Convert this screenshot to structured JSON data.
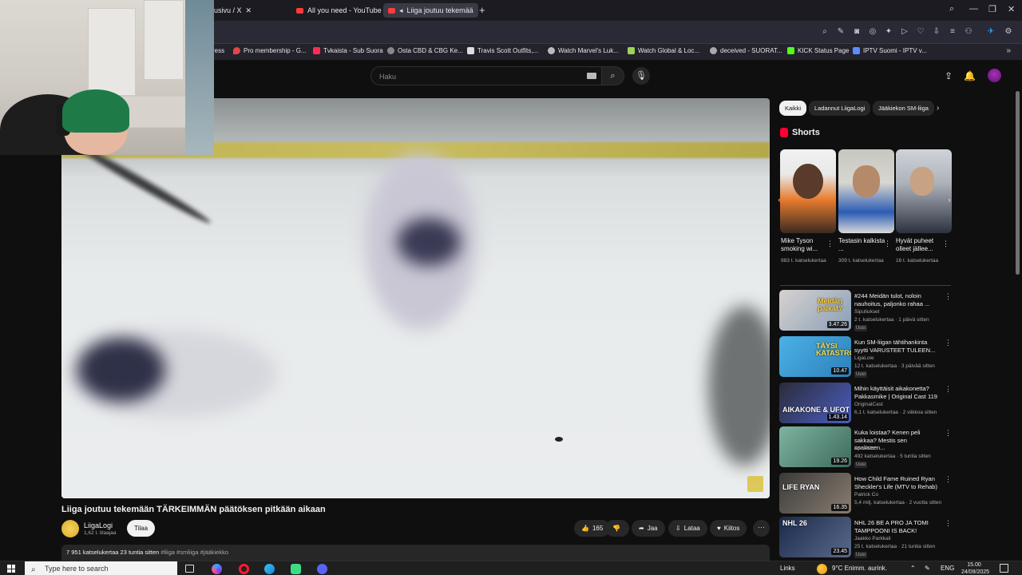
{
  "browser": {
    "tabs": [
      {
        "label": "usivu / X",
        "active": false
      },
      {
        "label": "All you need - YouTube",
        "active": false
      },
      {
        "label": "Liiga joutuu tekemää",
        "active": true
      }
    ],
    "new_tab": "+",
    "bookmarks": [
      {
        "label": "ress",
        "color": "#777777"
      },
      {
        "label": "Pro membership - G...",
        "color": "#e04848"
      },
      {
        "label": "Tvkaista - Sub Suora",
        "color": "#ff2d55"
      },
      {
        "label": "Osta CBD & CBG Ke...",
        "color": "#888888"
      },
      {
        "label": "Travis Scott Outfits,...",
        "color": "#dddddd"
      },
      {
        "label": "Watch Marvel's Luk...",
        "color": "#bbbbbb"
      },
      {
        "label": "Watch Global & Loc...",
        "color": "#9bd35a"
      },
      {
        "label": "deceived - SUORAT...",
        "color": "#aaaaaa"
      },
      {
        "label": "KICK Status Page",
        "color": "#53fc18"
      },
      {
        "label": "IPTV Suomi - IPTV v...",
        "color": "#5c8cff"
      }
    ],
    "bookmarks_more": "»"
  },
  "youtube_header": {
    "search_placeholder": "Haku"
  },
  "video": {
    "title": "Liiga joutuu tekemään TÄRKEIMMÄN päätöksen pitkään aikaan",
    "channel": "LiigaLogi",
    "subscribers": "1,62 t. tilaajaa",
    "subscribe_label": "Tilaa",
    "likes": "165",
    "share_label": "Jaa",
    "download_label": "Lataa",
    "thanks_label": "Kiitos",
    "stats": "7 951 katselukertaa  23 tuntia sitten",
    "tags": "#liiga #smliiga #jääkiekko"
  },
  "chips": [
    {
      "label": "Kaikki",
      "active": true
    },
    {
      "label": "Ladannut LiigaLogi",
      "active": false
    },
    {
      "label": "Jääkiekon SM-liiga",
      "active": false
    }
  ],
  "shorts": {
    "title": "Shorts",
    "items": [
      {
        "title": "Mike Tyson smoking wi...",
        "views": "983 t. katselukertaa"
      },
      {
        "title": "Testasin kalkista ...",
        "views": "309 t. katselukertaa"
      },
      {
        "title": "Hyvät puheet olleet jällee...",
        "views": "16 t. katselukertaa"
      }
    ]
  },
  "recommendations": [
    {
      "title": "#244 Meidän tulot, noloin nauhoitus, paljonko rahaa ...",
      "channel": "Sipuliukset",
      "meta": "2 t. katselukertaa · 1 päivä sitten",
      "badge": "Uusi",
      "duration": "3.47.26",
      "thumb_text": "Meidän palkat?"
    },
    {
      "title": "Kun SM-liigan tähtihankinta syytti VARUSTEET TULEEN...",
      "channel": "LigaLoie",
      "meta": "12 t. katselukertaa · 3 päivää sitten",
      "badge": "Uusi",
      "duration": "10.47",
      "thumb_text": "TÄYSI KATASTROFI"
    },
    {
      "title": "Mihin käyttäisit aikakonetta? Pakkasmike | Original Cast 119",
      "channel": "OriginalCast",
      "meta": "6,1 t. katselukertaa · 2 viikkoa sitten",
      "badge": "",
      "duration": "1.43.14",
      "thumb_text": "AIKAKONE & UFOT"
    },
    {
      "title": "Kuka loistaa? Kenen peli sakkaa? Mestis sen osakseen...",
      "channel": "Apu Arto",
      "meta": "492 katselukertaa · 5 tuntia sitten",
      "badge": "Uusi",
      "duration": "19.26",
      "thumb_text": ""
    },
    {
      "title": "How Child Fame Ruined Ryan Sheckler's Life (MTV to Rehab)",
      "channel": "Patrick Co",
      "meta": "5,4 milj. katselukertaa · 2 vuotta sitten",
      "badge": "",
      "duration": "16.35",
      "thumb_text": "LIFE RYAN"
    },
    {
      "title": "NHL 26 BE A PRO JA TOMI TAMPPOONI IS BACK!",
      "channel": "Jaakko Parkkali",
      "meta": "25 t. katselukertaa · 21 tuntia sitten",
      "badge": "Uusi",
      "duration": "23.45",
      "thumb_text": "NHL 26"
    }
  ],
  "taskbar": {
    "search_placeholder": "Type here to search",
    "links": "Links",
    "weather": "9°C  Enimm. aurink.",
    "lang": "ENG",
    "time": "15.00",
    "date": "24/09/2025"
  }
}
